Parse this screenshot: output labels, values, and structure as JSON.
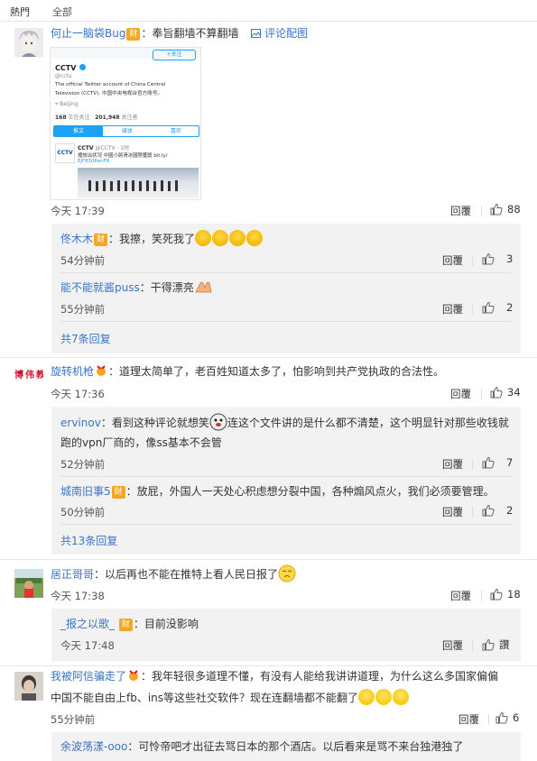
{
  "tabs": {
    "hot": "熱門",
    "all": "全部"
  },
  "labels": {
    "reply": "回覆",
    "view_pic": "评论配图",
    "like_text": "讚"
  },
  "screenshot": {
    "name": "CCTV",
    "handle": "@cctv",
    "follow": "+关注",
    "bio1": "The official Twitter account of China Central",
    "bio2": "Television (CCTV). 中国中央电视台官方账号。",
    "location": "Beijing",
    "following": "168",
    "following_label": "正在关注",
    "followers": "201,948",
    "followers_label": "关注者",
    "tab1": "推文",
    "tab2": "媒体",
    "tab3": "喜欢",
    "tweet_name": "CCTV",
    "tweet_handle": "@CCTV · 1时",
    "tweet_line1": "播放出状况 中國小將滑冰國際獲獎 bit.ly/",
    "tweet_line2": "EJF8308enFR"
  },
  "comments": [
    {
      "user": "何止一脑袋Bug",
      "badge": "财",
      "text": "：奉旨翻墙不算翻墙",
      "time": "今天 17:39",
      "likes": "88",
      "replies": [
        {
          "user": "佟木木",
          "badge": "财",
          "text": "：我擦，笑死我了",
          "time": "54分钟前",
          "likes": "3"
        },
        {
          "user": "能不能就酱puss",
          "text": "：干得漂亮",
          "time": "55分钟前",
          "likes": "2"
        }
      ],
      "more": "共7条回复"
    },
    {
      "user": "旋转机枪",
      "avatar_text": "博伟教育",
      "text": "：道理太简单了，老百姓知道太多了，怕影响到共产党执政的合法性。",
      "time": "今天 17:36",
      "likes": "34",
      "replies": [
        {
          "user": "ervinov",
          "text1": "：看到这种评论就想笑",
          "text2": "连这个文件讲的是什么都不清楚，这个明显针对那些收钱就",
          "text3": "跑的vpn厂商的，像ss基本不会管",
          "time": "52分钟前",
          "likes": "7"
        },
        {
          "user": "城南旧事5",
          "badge": "财",
          "text": "：放屁，外国人一天处心积虑想分裂中国，各种煽风点火，我们必须要管理。",
          "time": "50分钟前",
          "likes": "2"
        }
      ],
      "more": "共13条回复"
    },
    {
      "user": "居正哥哥",
      "text": "：以后再也不能在推特上看人民日报了",
      "time": "今天 17:38",
      "likes": "18",
      "replies": [
        {
          "user": "_报之以歌_",
          "badge": "财",
          "text": "：目前没影响",
          "time": "今天 17:48"
        }
      ]
    },
    {
      "user": "我被阿信骗走了",
      "text1": "：我年轻很多道理不懂，有没有人能给我讲讲道理，为什么这么多国家偏偏",
      "text2": "中国不能自由上fb、ins等这些社交软件？现在连翻墙都不能翻了",
      "time": "55分钟前",
      "likes": "6",
      "replies": [
        {
          "user": "余波荡漾-ooo",
          "text": "：可怜帝吧才出征去骂日本的那个酒店。以后看来是骂不来台独港独了"
        }
      ]
    }
  ]
}
